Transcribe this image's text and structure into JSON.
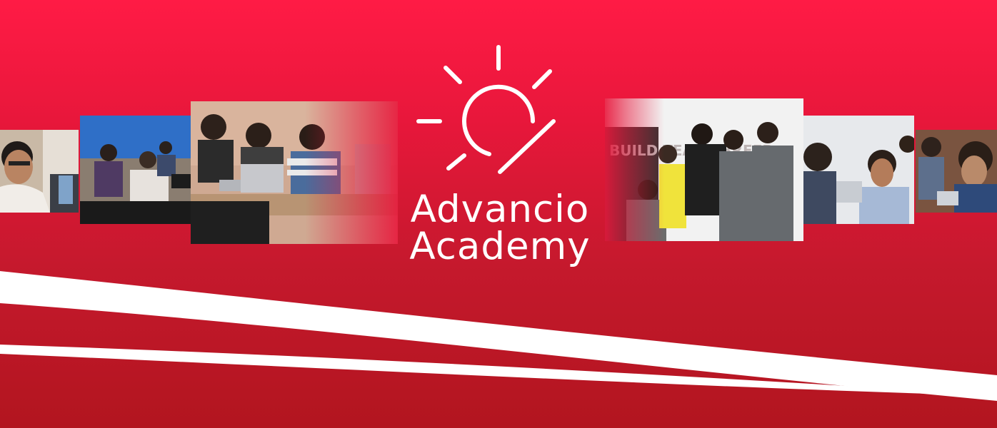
{
  "banner": {
    "brand_line_1": "Advancio",
    "brand_line_2": "Academy",
    "logo_icon": "sun-bulb-icon",
    "accent_color": "#e8173b",
    "stripe_color": "#ffffff"
  },
  "photos": [
    {
      "name": "classroom-student-closeup-photo"
    },
    {
      "name": "classroom-laptops-photo"
    },
    {
      "name": "classroom-students-laptops-photo"
    },
    {
      "name": "team-group-photo"
    },
    {
      "name": "student-thinking-photo"
    },
    {
      "name": "student-laptop-photo"
    }
  ],
  "team_wall_text": "BUILD TEACH BREED"
}
